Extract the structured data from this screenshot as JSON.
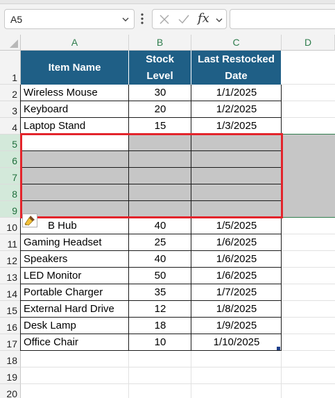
{
  "name_box": {
    "value": "A5"
  },
  "formula_bar": {
    "fx_label": "fx",
    "value": ""
  },
  "icons": {
    "name_box_dropdown": "chevron-down-icon",
    "more": "vertical-dots-icon",
    "cancel": "x-icon",
    "enter": "check-icon",
    "paste_options": "paintbrush-icon",
    "corner": "select-all-triangle"
  },
  "columns": [
    "A",
    "B",
    "C",
    "D"
  ],
  "row_numbers": [
    "1",
    "2",
    "3",
    "4",
    "5",
    "6",
    "7",
    "8",
    "9",
    "10",
    "11",
    "12",
    "13",
    "14",
    "15",
    "16",
    "17",
    "18",
    "19",
    "20"
  ],
  "table": {
    "headers": {
      "item": "Item Name",
      "stock_line1": "Stock",
      "stock_line2": "Level",
      "date_line1": "Last Restocked",
      "date_line2": "Date"
    },
    "rows": [
      {
        "row": "2",
        "item": "Wireless Mouse",
        "stock": "30",
        "date": "1/1/2025"
      },
      {
        "row": "3",
        "item": "Keyboard",
        "stock": "20",
        "date": "1/2/2025"
      },
      {
        "row": "4",
        "item": "Laptop Stand",
        "stock": "15",
        "date": "1/3/2025"
      },
      {
        "row": "5",
        "item": "",
        "stock": "",
        "date": ""
      },
      {
        "row": "6",
        "item": "",
        "stock": "",
        "date": ""
      },
      {
        "row": "7",
        "item": "",
        "stock": "",
        "date": ""
      },
      {
        "row": "8",
        "item": "",
        "stock": "",
        "date": ""
      },
      {
        "row": "9",
        "item": "",
        "stock": "",
        "date": ""
      },
      {
        "row": "10",
        "item": "B Hub",
        "stock": "40",
        "date": "1/5/2025"
      },
      {
        "row": "11",
        "item": "Gaming Headset",
        "stock": "25",
        "date": "1/6/2025"
      },
      {
        "row": "12",
        "item": "Speakers",
        "stock": "40",
        "date": "1/6/2025"
      },
      {
        "row": "13",
        "item": "LED Monitor",
        "stock": "50",
        "date": "1/6/2025"
      },
      {
        "row": "14",
        "item": "Portable Charger",
        "stock": "35",
        "date": "1/7/2025"
      },
      {
        "row": "15",
        "item": "External Hard Drive",
        "stock": "12",
        "date": "1/8/2025"
      },
      {
        "row": "16",
        "item": "Desk Lamp",
        "stock": "18",
        "date": "1/9/2025"
      },
      {
        "row": "17",
        "item": "Office Chair",
        "stock": "10",
        "date": "1/10/2025"
      }
    ]
  },
  "selection": {
    "range": "A5:D9",
    "active_cell": "A5",
    "highlight_color": "#e3242b"
  },
  "colors": {
    "header_fill": "#1f5f86",
    "header_text": "#ffffff",
    "selected_header": "#d3e9da",
    "selection_fill": "#c6c6c6"
  }
}
